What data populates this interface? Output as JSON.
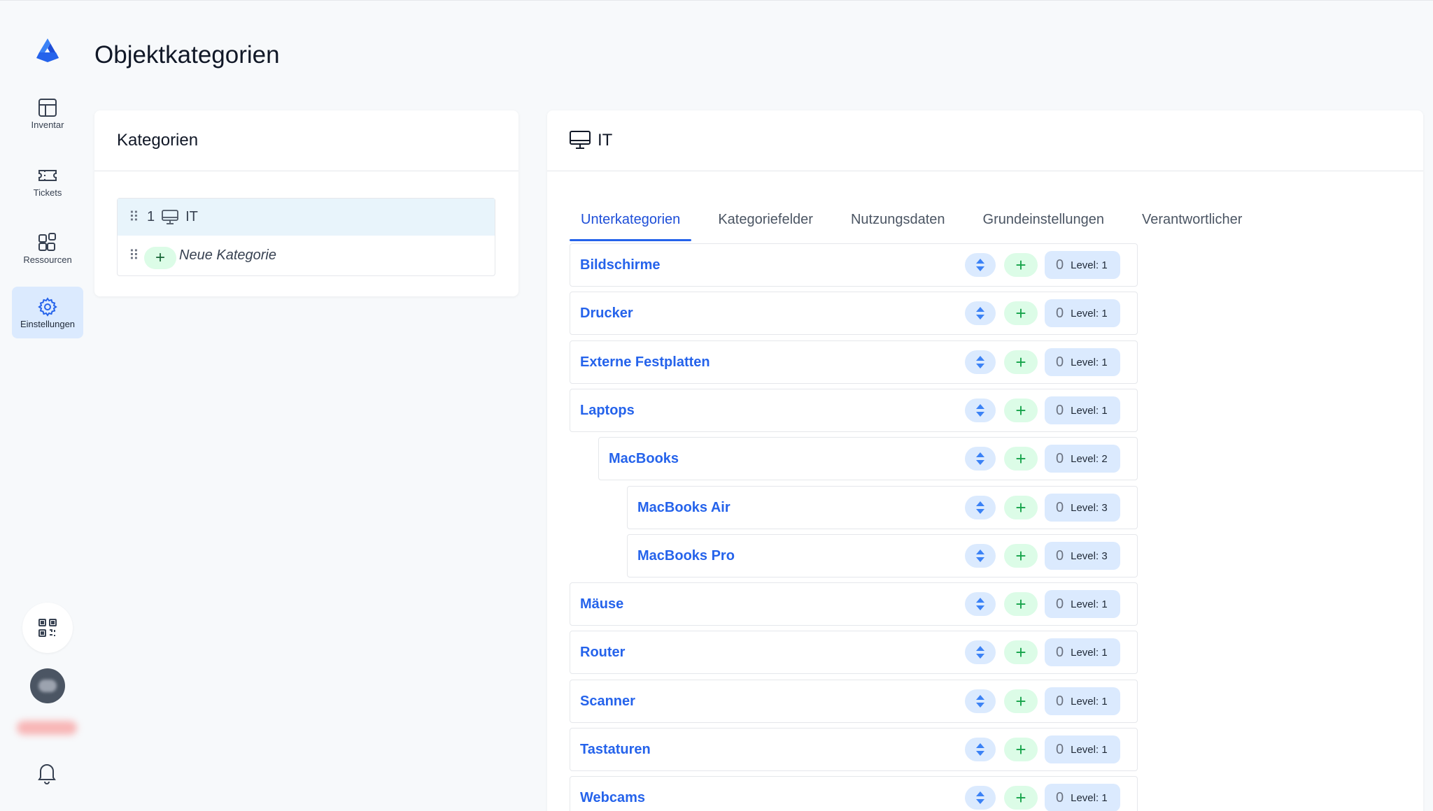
{
  "app": {
    "page_title": "Objektkategorien"
  },
  "sidebar": {
    "items": [
      {
        "label": "Inventar",
        "icon": "table-icon",
        "active": false
      },
      {
        "label": "Tickets",
        "icon": "ticket-icon",
        "active": false
      },
      {
        "label": "Ressourcen",
        "icon": "resources-icon",
        "active": false
      },
      {
        "label": "Einstellungen",
        "icon": "gear-icon",
        "active": true
      }
    ]
  },
  "categories": {
    "title": "Kategorien",
    "items": [
      {
        "number": "1",
        "icon": "monitor-icon",
        "label": "IT",
        "selected": true
      }
    ],
    "new_label": "Neue Kategorie",
    "new_plus": "+"
  },
  "detail": {
    "title": "IT",
    "icon": "monitor-icon",
    "tabs": [
      {
        "label": "Unterkategorien",
        "active": true
      },
      {
        "label": "Kategoriefelder",
        "active": false
      },
      {
        "label": "Nutzungsdaten",
        "active": false
      },
      {
        "label": "Grundeinstellungen",
        "active": false
      },
      {
        "label": "Verantwortlicher",
        "active": false
      }
    ],
    "subcategories": [
      {
        "name": "Bildschirme",
        "count": "0",
        "level": "Level: 1"
      },
      {
        "name": "Drucker",
        "count": "0",
        "level": "Level: 1"
      },
      {
        "name": "Externe Festplatten",
        "count": "0",
        "level": "Level: 1"
      },
      {
        "name": "Laptops",
        "count": "0",
        "level": "Level: 1"
      },
      {
        "name": "MacBooks",
        "count": "0",
        "level": "Level: 2"
      },
      {
        "name": "MacBooks Air",
        "count": "0",
        "level": "Level: 3"
      },
      {
        "name": "MacBooks Pro",
        "count": "0",
        "level": "Level: 3"
      },
      {
        "name": "Mäuse",
        "count": "0",
        "level": "Level: 1"
      },
      {
        "name": "Router",
        "count": "0",
        "level": "Level: 1"
      },
      {
        "name": "Scanner",
        "count": "0",
        "level": "Level: 1"
      },
      {
        "name": "Tastaturen",
        "count": "0",
        "level": "Level: 1"
      },
      {
        "name": "Webcams",
        "count": "0",
        "level": "Level: 1"
      }
    ],
    "add_symbol": "+"
  },
  "colors": {
    "accent": "#2563eb",
    "active_nav_bg": "#dbeafe",
    "add_bg": "#dcfce7",
    "selected_row_bg": "#e8f4fb"
  }
}
